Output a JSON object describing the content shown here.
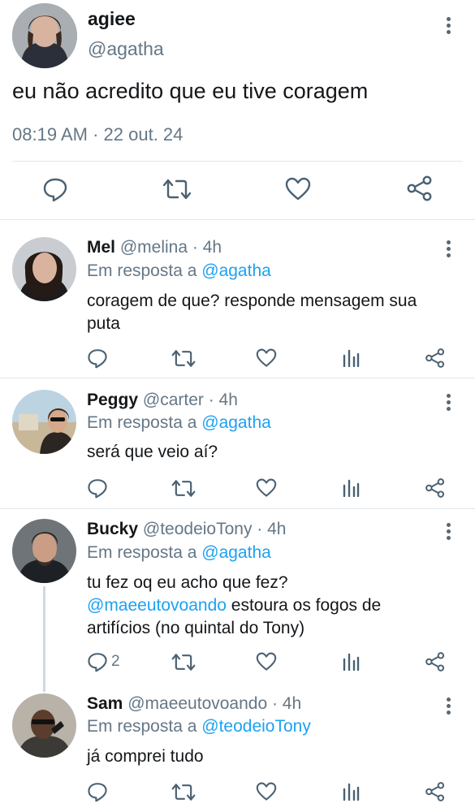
{
  "main": {
    "display_name": "agiee",
    "handle": "@agatha",
    "text": "eu não acredito que eu tive coragem",
    "time": "08:19 AM",
    "separator": "·",
    "date": "22 out. 24"
  },
  "replies": [
    {
      "name": "Mel",
      "handle": "@melina",
      "age": "· 4h",
      "replying_label": "Em resposta a",
      "replying_to": "@agatha",
      "text": "coragem de que? responde mensagem sua puta"
    },
    {
      "name": "Peggy",
      "handle": "@carter",
      "age": "· 4h",
      "replying_label": "Em resposta a",
      "replying_to": "@agatha",
      "text": "será que veio aí?"
    },
    {
      "name": "Bucky",
      "handle": "@teodeioTony",
      "age": "· 4h",
      "replying_label": "Em resposta a",
      "replying_to": "@agatha",
      "text_line1": "tu fez oq eu acho que fez?",
      "text_mention": "@maeeutovoando",
      "text_rest": " estoura os fogos de artifícios (no quintal do Tony)",
      "reply_count": "2"
    },
    {
      "name": "Sam",
      "handle": "@maeeutovoando",
      "age": "· 4h",
      "replying_label": "Em resposta a",
      "replying_to": "@teodeioTony",
      "text": "já comprei tudo"
    }
  ],
  "icons": {
    "reply": "reply-icon",
    "retweet": "retweet-icon",
    "like": "heart-icon",
    "stats": "stats-icon",
    "share": "share-icon",
    "more": "more-vertical-icon"
  },
  "colors": {
    "text": "#14171a",
    "secondary": "#657786",
    "link": "#1da1f2",
    "divider": "#e1e8ed"
  }
}
